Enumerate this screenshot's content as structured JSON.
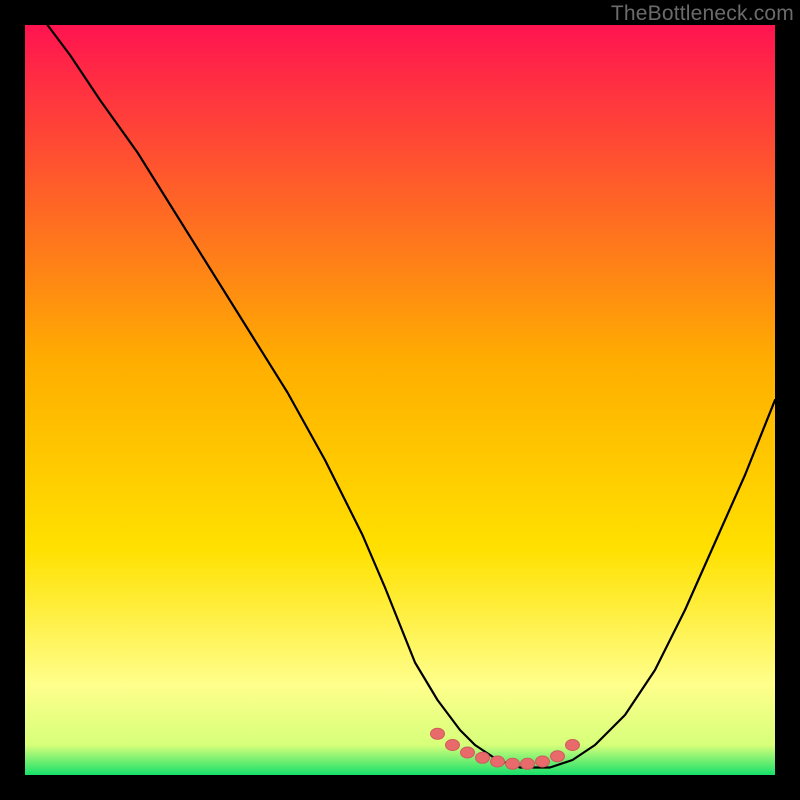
{
  "watermark": "TheBottleneck.com",
  "colors": {
    "gradient_top": "#ff1450",
    "gradient_mid": "#ffd400",
    "gradient_low": "#ffff7a",
    "gradient_bottom": "#16e06a",
    "curve": "#000000",
    "marker_fill": "#e86a6a",
    "marker_stroke": "#cf5c5c"
  },
  "chart_data": {
    "type": "line",
    "title": "",
    "xlabel": "",
    "ylabel": "",
    "xlim": [
      0,
      100
    ],
    "ylim": [
      0,
      100
    ],
    "series": [
      {
        "name": "bottleneck-curve",
        "x": [
          3,
          6,
          10,
          15,
          20,
          25,
          30,
          35,
          40,
          45,
          48,
          50,
          52,
          55,
          58,
          60,
          63,
          66,
          68,
          70,
          73,
          76,
          80,
          84,
          88,
          92,
          96,
          100
        ],
        "values": [
          100,
          96,
          90,
          83,
          75,
          67,
          59,
          51,
          42,
          32,
          25,
          20,
          15,
          10,
          6,
          4,
          2,
          1,
          1,
          1,
          2,
          4,
          8,
          14,
          22,
          31,
          40,
          50
        ]
      }
    ],
    "markers": {
      "name": "optimal-range-markers",
      "x": [
        55,
        57,
        59,
        61,
        63,
        65,
        67,
        69,
        71,
        73
      ],
      "values": [
        5.5,
        4.0,
        3.0,
        2.3,
        1.8,
        1.5,
        1.5,
        1.8,
        2.5,
        4.0
      ]
    }
  }
}
